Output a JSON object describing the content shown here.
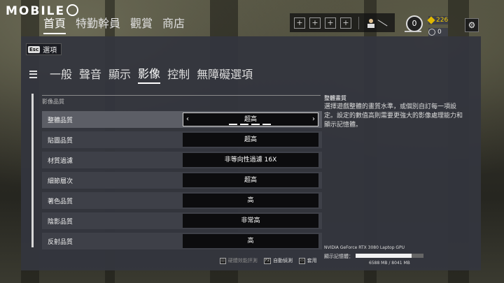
{
  "watermark": {
    "text": "MOBILE"
  },
  "nav": {
    "items": [
      "首頁",
      "特勤幹員",
      "觀賞",
      "商店"
    ]
  },
  "loadout": {
    "slots": [
      "+",
      "+",
      "+",
      "+"
    ]
  },
  "player": {
    "level": "0",
    "renown": "226",
    "credits": "0"
  },
  "back": {
    "key": "Esc",
    "label": "選項"
  },
  "tabs": [
    "一般",
    "聲音",
    "顯示",
    "影像",
    "控制",
    "無障礙選項"
  ],
  "section_title": "影像品質",
  "settings": [
    {
      "label": "整體品質",
      "value": "超高"
    },
    {
      "label": "貼圖品質",
      "value": "超高"
    },
    {
      "label": "材質過濾",
      "value": "非等向性過濾 16X"
    },
    {
      "label": "細節層次",
      "value": "超高"
    },
    {
      "label": "著色品質",
      "value": "高"
    },
    {
      "label": "陰影品質",
      "value": "非常高"
    },
    {
      "label": "反射品質",
      "value": "高"
    }
  ],
  "description": {
    "title": "整體畫質",
    "text": "選擇遊戲整體的畫質水準，或個別自訂每一項設定。設定的數值高則需要更強大的影像處理能力和顯示記憶體。"
  },
  "gpu": {
    "name": "NVIDIA GeForce RTX 3080 Laptop GPU",
    "memory_label": "顯示記憶體：",
    "memory_value": "6588 MB / 8041 MB",
    "memory_fraction": 0.82
  },
  "footer": {
    "benchmark": "硬體效能評測",
    "auto_key": "F2",
    "auto": "自動偵測",
    "apply": "套用"
  }
}
